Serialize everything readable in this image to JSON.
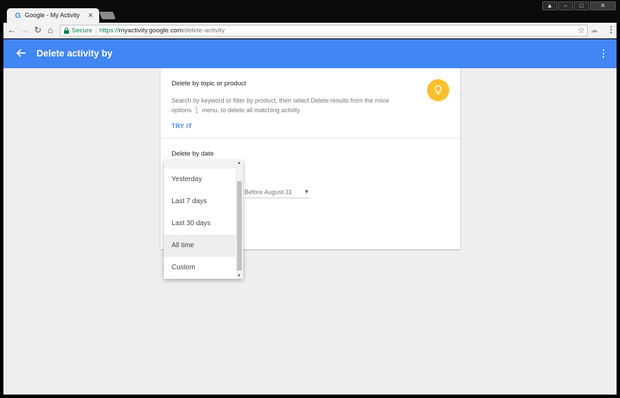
{
  "browser": {
    "tab_title": "Google - My Activity",
    "tab_favicon": "G",
    "secure_label": "Secure",
    "url_scheme": "https://",
    "url_host": "myactivity.google.com",
    "url_path": "/delete-activity"
  },
  "appbar": {
    "title": "Delete activity by",
    "color": "#4285f4"
  },
  "topic_section": {
    "title": "Delete by topic or product",
    "desc_part1": "Search by keyword or filter by product, then select Delete results from the more options",
    "desc_part2": "menu, to delete all matching activity",
    "action": "TRY IT"
  },
  "date_section": {
    "title": "Delete by date",
    "before_value": "Before August 31"
  },
  "dropdown": {
    "options": [
      {
        "label": "Yesterday"
      },
      {
        "label": "Last 7 days"
      },
      {
        "label": "Last 30 days"
      },
      {
        "label": "All time"
      },
      {
        "label": "Custom"
      }
    ],
    "selected": "All time"
  },
  "icons": {
    "back": "arrow-left-icon",
    "more": "more-vert-icon",
    "bulb": "lightbulb-icon",
    "lock": "lock-icon",
    "star": "star-icon"
  }
}
